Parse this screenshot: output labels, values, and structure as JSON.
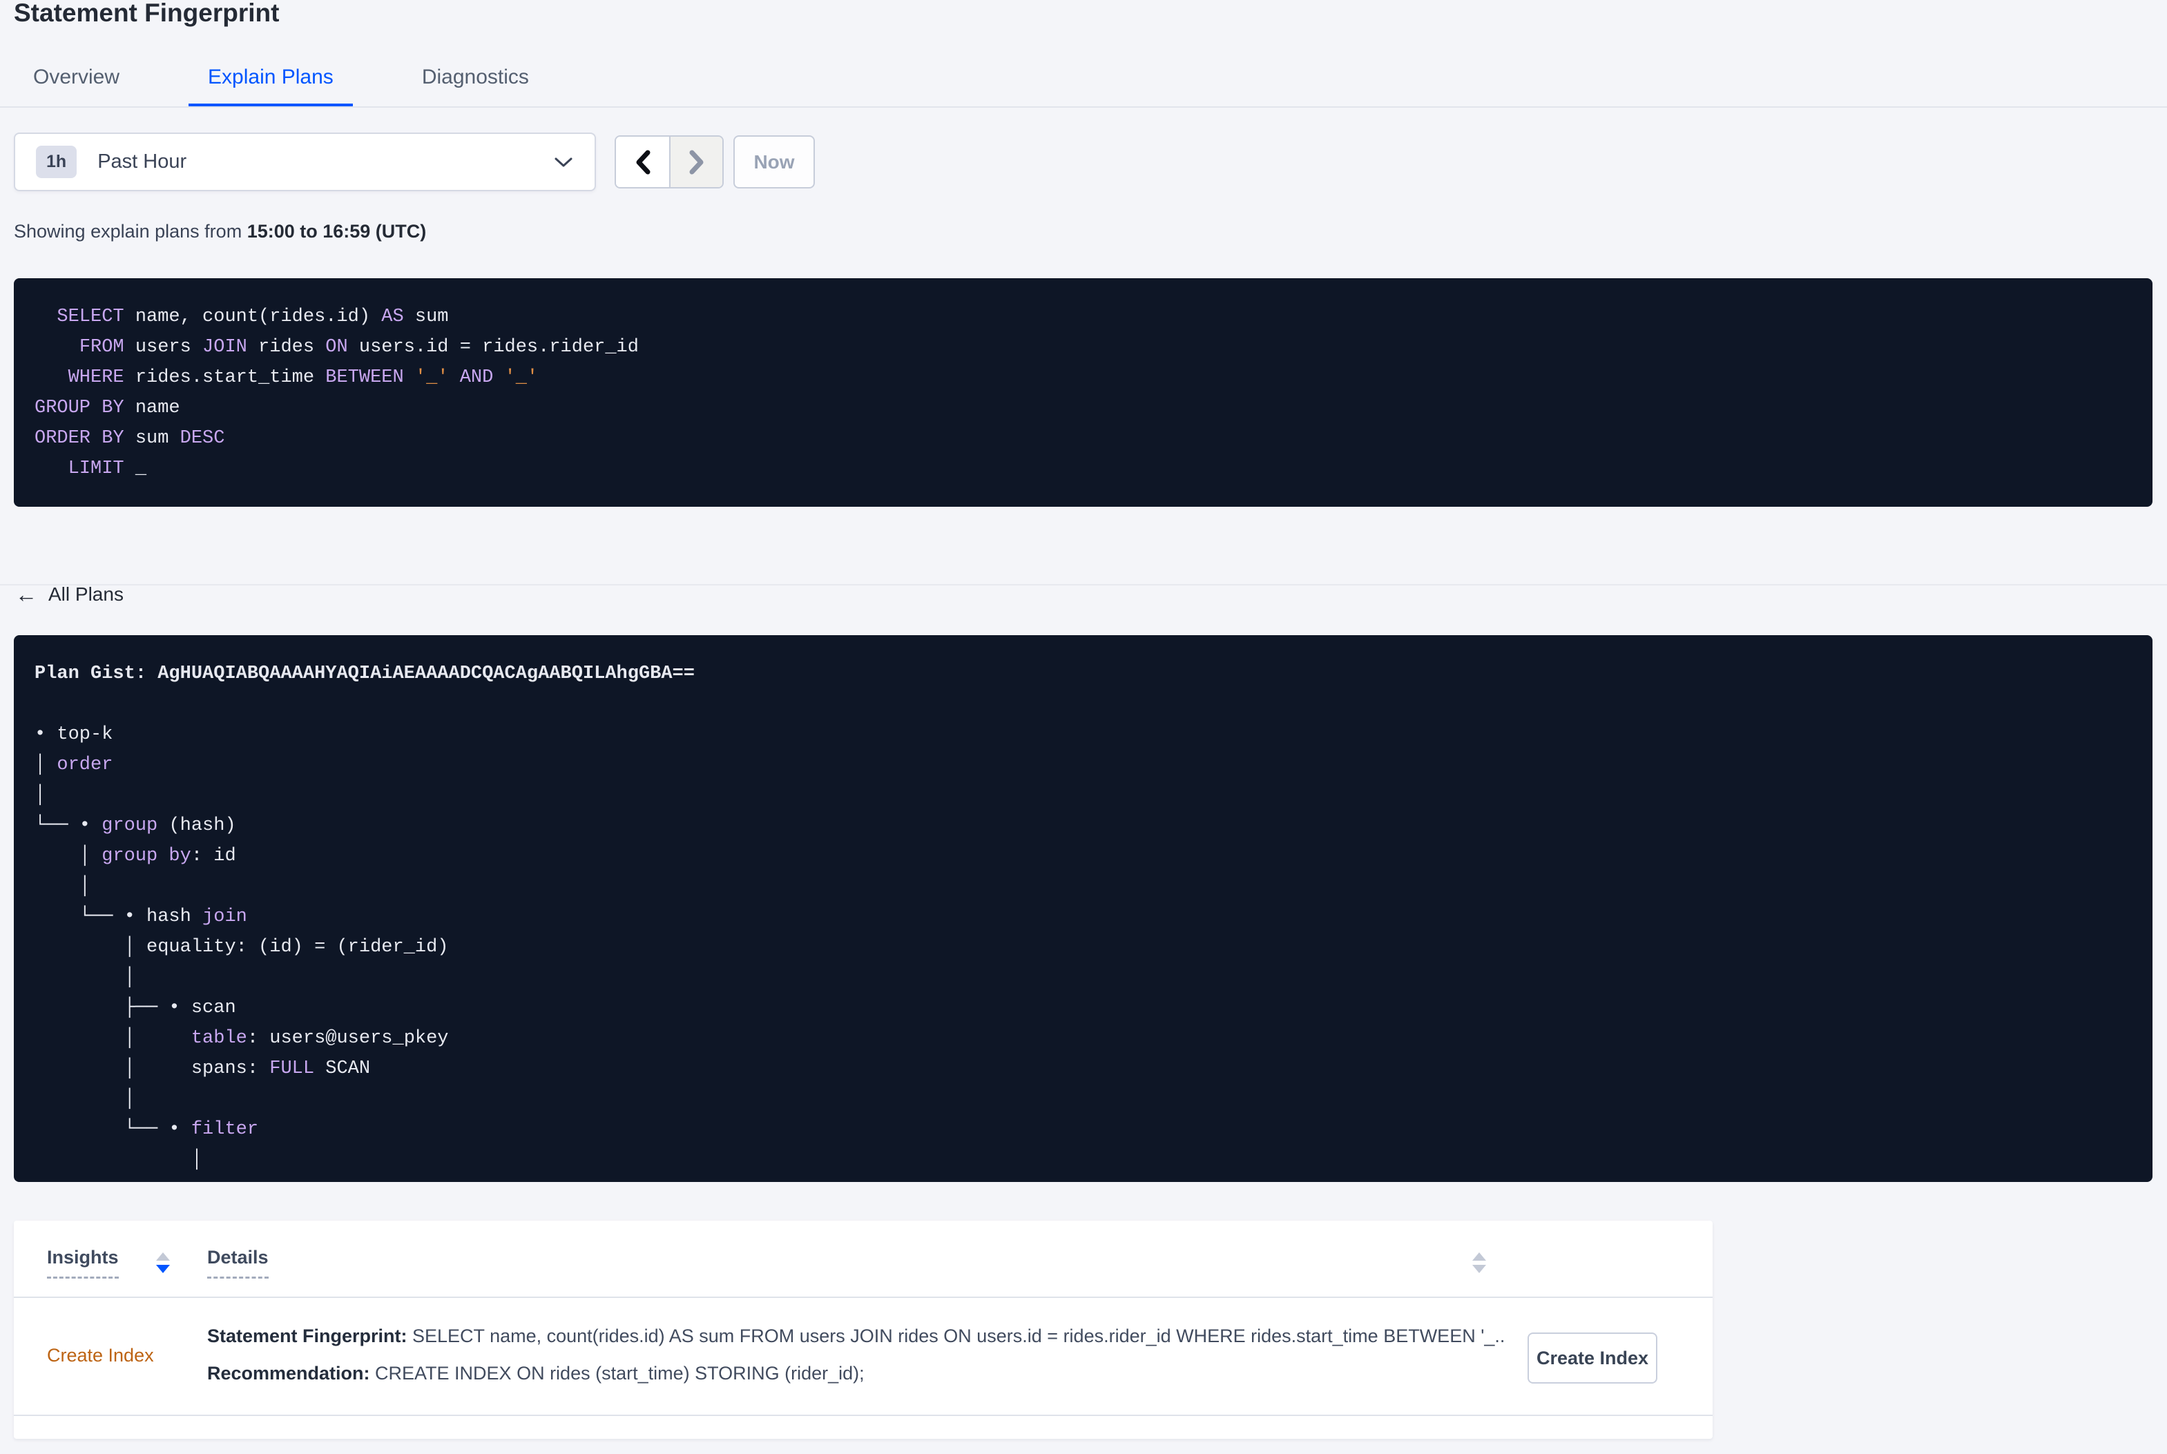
{
  "page": {
    "title": "Statement Fingerprint"
  },
  "tabs": [
    {
      "label": "Overview",
      "active": false
    },
    {
      "label": "Explain Plans",
      "active": true
    },
    {
      "label": "Diagnostics",
      "active": false
    }
  ],
  "time_picker": {
    "badge": "1h",
    "label": "Past Hour",
    "now_label": "Now"
  },
  "subtitle": {
    "prefix": "Showing explain plans from ",
    "bold": "15:00 to 16:59 (UTC)"
  },
  "sql_query": {
    "lines": [
      [
        [
          "id",
          "  "
        ],
        [
          "kw",
          "SELECT"
        ],
        [
          "id",
          " name, count(rides.id) "
        ],
        [
          "kw",
          "AS"
        ],
        [
          "id",
          " sum"
        ]
      ],
      [
        [
          "id",
          "    "
        ],
        [
          "kw",
          "FROM"
        ],
        [
          "id",
          " users "
        ],
        [
          "kw",
          "JOIN"
        ],
        [
          "id",
          " rides "
        ],
        [
          "kw",
          "ON"
        ],
        [
          "id",
          " users.id = rides.rider_id"
        ]
      ],
      [
        [
          "id",
          "   "
        ],
        [
          "kw",
          "WHERE"
        ],
        [
          "id",
          " rides.start_time "
        ],
        [
          "kw",
          "BETWEEN"
        ],
        [
          "id",
          " "
        ],
        [
          "str",
          "'_'"
        ],
        [
          "id",
          " "
        ],
        [
          "kw",
          "AND"
        ],
        [
          "id",
          " "
        ],
        [
          "str",
          "'_'"
        ]
      ],
      [
        [
          "kw",
          "GROUP BY"
        ],
        [
          "id",
          " name"
        ]
      ],
      [
        [
          "kw",
          "ORDER BY"
        ],
        [
          "id",
          " sum "
        ],
        [
          "kw",
          "DESC"
        ]
      ],
      [
        [
          "id",
          "   "
        ],
        [
          "kw",
          "LIMIT"
        ],
        [
          "id",
          " _"
        ]
      ]
    ]
  },
  "back_link": {
    "label": "All Plans"
  },
  "plan": {
    "gist": "Plan Gist: AgHUAQIABQAAAAHYAQIAiAEAAAADCQACAgAABQILAhgGBA==",
    "tree": [
      [],
      [
        [
          "id",
          "• top-k"
        ]
      ],
      [
        [
          "id",
          "│ "
        ],
        [
          "kw",
          "order"
        ]
      ],
      [
        [
          "id",
          "│"
        ]
      ],
      [
        [
          "id",
          "└── • "
        ],
        [
          "kw",
          "group"
        ],
        [
          "id",
          " (hash)"
        ]
      ],
      [
        [
          "id",
          "    │ "
        ],
        [
          "kw",
          "group by"
        ],
        [
          "id",
          ": id"
        ]
      ],
      [
        [
          "id",
          "    │"
        ]
      ],
      [
        [
          "id",
          "    └── • hash "
        ],
        [
          "kw",
          "join"
        ]
      ],
      [
        [
          "id",
          "        │ equality: (id) = (rider_id)"
        ]
      ],
      [
        [
          "id",
          "        │"
        ]
      ],
      [
        [
          "id",
          "        ├── • scan"
        ]
      ],
      [
        [
          "id",
          "        │     "
        ],
        [
          "kw",
          "table"
        ],
        [
          "id",
          ": users@users_pkey"
        ]
      ],
      [
        [
          "id",
          "        │     spans: "
        ],
        [
          "kw",
          "FULL"
        ],
        [
          "id",
          " SCAN"
        ]
      ],
      [
        [
          "id",
          "        │"
        ]
      ],
      [
        [
          "id",
          "        └── • "
        ],
        [
          "kw",
          "filter"
        ]
      ],
      [
        [
          "id",
          "              │"
        ]
      ]
    ]
  },
  "insights_table": {
    "columns": [
      {
        "label": "Insights"
      },
      {
        "label": "Details"
      }
    ],
    "rows": [
      {
        "insight": "Create Index",
        "details": [
          {
            "label": "Statement Fingerprint:",
            "text": " SELECT name, count(rides.id) AS sum FROM users JOIN rides ON users.id = rides.rider_id WHERE rides.start_time BETWEEN '_..."
          },
          {
            "label": "Recommendation:",
            "text": " CREATE INDEX ON rides (start_time) STORING (rider_id);"
          }
        ],
        "action": "Create Index"
      }
    ]
  },
  "colors": {
    "accent": "#0055ff",
    "code_bg": "#0e1626",
    "code_fg": "#e7e9f0",
    "code_keyword": "#c8a7f0",
    "code_string": "#e08e45",
    "insight_link": "#bd6414"
  }
}
